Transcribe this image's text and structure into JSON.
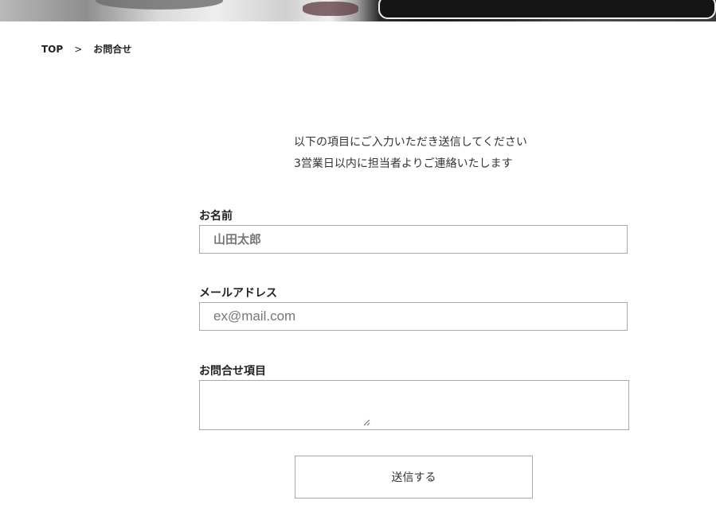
{
  "breadcrumb": {
    "home": "TOP",
    "separator": ">",
    "current": "お問合せ"
  },
  "intro": {
    "line1": "以下の項目にご入力いただき送信してください",
    "line2": "3営業日以内に担当者よりご連絡いたします"
  },
  "form": {
    "name_label": "お名前",
    "name_placeholder": "山田太郎",
    "email_label": "メールアドレス",
    "email_placeholder": "ex@mail.com",
    "inquiry_label": "お問合せ項目",
    "inquiry_value": "",
    "submit_label": "送信する"
  },
  "colors": {
    "border": "#a9a9a9",
    "text": "#222222",
    "background": "#ffffff"
  }
}
